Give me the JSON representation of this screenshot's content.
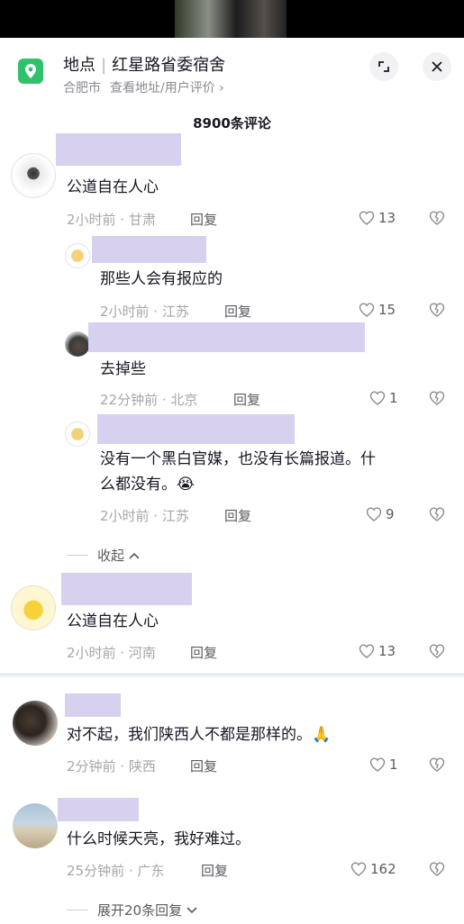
{
  "location": {
    "type_label": "地点",
    "name": "红星路省委宿舍",
    "city": "合肥市",
    "sub_link": "查看地址/用户评价 ›"
  },
  "comment_count": "8900条评论",
  "comments": [
    {
      "text": "公道自在人心",
      "time_loc": "2小时前 · 甘肃",
      "reply": "回复",
      "likes": "13"
    },
    {
      "text": "那些人会有报应的",
      "time_loc": "2小时前 · 江苏",
      "reply": "回复",
      "likes": "15"
    },
    {
      "text": "去掉些",
      "time_loc": "22分钟前 · 北京",
      "reply": "回复",
      "likes": "1"
    },
    {
      "text_line1": "没有一个黑白官媒，也没有长篇报道。什",
      "text_line2": "么都没有。",
      "emoji": "😭",
      "time_loc": "2小时前 · 江苏",
      "reply": "回复",
      "likes": "9"
    },
    {
      "text": "公道自在人心",
      "time_loc": "2小时前 · 河南",
      "reply": "回复",
      "likes": "13"
    },
    {
      "text": "对不起，我们陕西人不都是那样的。",
      "emoji": "🙏",
      "time_loc": "2分钟前 · 陕西",
      "reply": "回复",
      "likes": "1"
    },
    {
      "text": "什么时候天亮，我好难过。",
      "time_loc": "25分钟前 · 广东",
      "reply": "回复",
      "likes": "162"
    }
  ],
  "collapse_label": "收起",
  "expand_label": "展开20条回复",
  "colors": {
    "accent_green": "#2fc26a",
    "name_redaction": "#d7d0ee",
    "muted_text": "#a6a7ab"
  }
}
